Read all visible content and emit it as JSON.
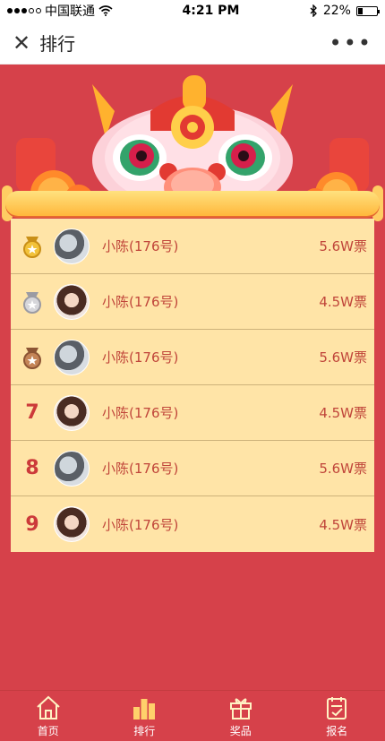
{
  "status": {
    "carrier": "中国联通",
    "time": "4:21 PM",
    "battery": "22%",
    "battery_level": 0.22
  },
  "navbar": {
    "title": "排行"
  },
  "ranking": [
    {
      "rank": "",
      "medal": "gold-medal-icon",
      "name": "小陈(176号)",
      "votes": "5.6W票",
      "avatar": "avatar-a"
    },
    {
      "rank": "",
      "medal": "silver-medal-icon",
      "name": "小陈(176号)",
      "votes": "4.5W票",
      "avatar": "avatar-b"
    },
    {
      "rank": "",
      "medal": "bronze-medal-icon",
      "name": "小陈(176号)",
      "votes": "5.6W票",
      "avatar": "avatar-a"
    },
    {
      "rank": "7",
      "medal": "",
      "name": "小陈(176号)",
      "votes": "4.5W票",
      "avatar": "avatar-b"
    },
    {
      "rank": "8",
      "medal": "",
      "name": "小陈(176号)",
      "votes": "5.6W票",
      "avatar": "avatar-a"
    },
    {
      "rank": "9",
      "medal": "",
      "name": "小陈(176号)",
      "votes": "4.5W票",
      "avatar": "avatar-b"
    }
  ],
  "tabbar": {
    "items": [
      {
        "label": "首页",
        "icon": "home-icon"
      },
      {
        "label": "排行",
        "icon": "ranking-icon"
      },
      {
        "label": "奖品",
        "icon": "gift-icon"
      },
      {
        "label": "报名",
        "icon": "signup-icon"
      }
    ]
  },
  "colors": {
    "background": "#d6414a",
    "list_bg": "#ffe4a7",
    "text_accent": "#c0453a"
  }
}
